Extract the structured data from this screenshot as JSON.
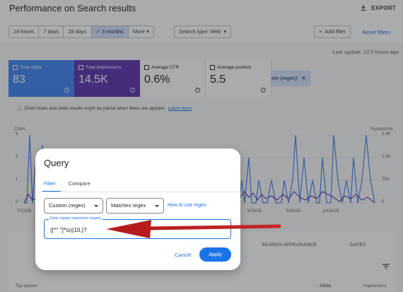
{
  "header": {
    "title": "Performance on Search results",
    "export_label": "EXPORT"
  },
  "date_range": {
    "options": [
      "24 hours",
      "7 days",
      "28 days",
      "3 months",
      "More"
    ],
    "selected": "3 months"
  },
  "filters": {
    "search_type": "Search type: Web",
    "query_filter": "Query: Custom (regex)",
    "add_filter": "Add filter",
    "reset": "Reset filters"
  },
  "last_update": "Last update: 12.5 hours ago",
  "metrics": [
    {
      "label": "Total clicks",
      "value": "83",
      "checked": true
    },
    {
      "label": "Total impressions",
      "value": "14.5K",
      "checked": true
    },
    {
      "label": "Average CTR",
      "value": "0.6%",
      "checked": false
    },
    {
      "label": "Average position",
      "value": "5.5",
      "checked": false
    }
  ],
  "notice": {
    "text": "Chart totals and table results might be partial when filters are applied.",
    "link": "Learn more"
  },
  "chart_data": {
    "type": "line",
    "y_left_label": "Clicks",
    "y_right_label": "Impressions",
    "y_left_ticks": [
      "3",
      "2",
      "1",
      "0"
    ],
    "y_right_ticks": [
      "2.3K",
      "1.5K",
      "750",
      "0"
    ],
    "x_ticks": [
      "7/22/25",
      "9/20/25",
      "9/30/25",
      "10/10/25",
      "10/20/25"
    ],
    "colors": {
      "clicks": "#4285f4",
      "impressions": "#5e35b1"
    }
  },
  "bottom": {
    "tabs": [
      "SEARCH APPEARANCE",
      "DATES"
    ],
    "col_query": "Top queries",
    "col_clicks": "Clicks",
    "col_impressions": "Impressions"
  },
  "dialog": {
    "title": "Query",
    "tabs": [
      "Filter",
      "Compare"
    ],
    "match_type": "Custom (regex)",
    "condition": "Matches regex",
    "help_link": "How to use regex",
    "input_label": "Enter regular expression (regex)",
    "input_value": "([^\" \"]*\\s){10,}?",
    "cancel": "Cancel",
    "apply": "Apply"
  }
}
